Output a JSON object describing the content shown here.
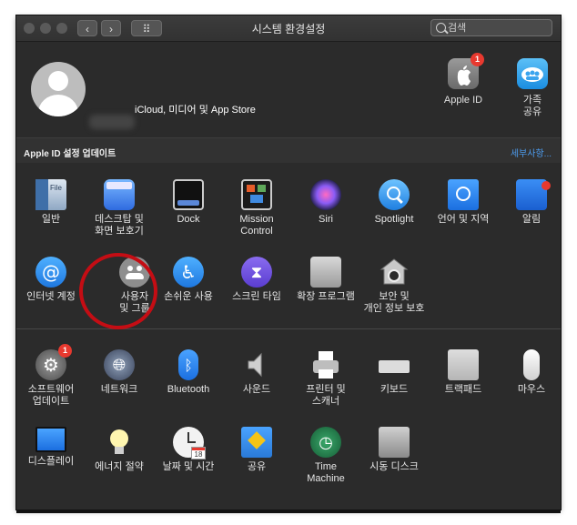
{
  "window": {
    "title": "시스템 환경설정"
  },
  "nav": {
    "back": "‹",
    "forward": "›",
    "grid": "⠿"
  },
  "search": {
    "placeholder": "검색"
  },
  "profile": {
    "subtitle": "iCloud, 미디어 및 App Store"
  },
  "top_items": [
    {
      "label": "Apple ID",
      "icon": "apple-icon",
      "badge": "1"
    },
    {
      "label": "가족\n공유",
      "icon": "family-sharing-icon"
    }
  ],
  "banner": {
    "left": "Apple ID 설정 업데이트",
    "right": "세부사항..."
  },
  "row1": [
    {
      "label": "일반",
      "icon": "general-icon"
    },
    {
      "label": "데스크탑 및\n화면 보호기",
      "icon": "desktop-icon"
    },
    {
      "label": "Dock",
      "icon": "dock-icon"
    },
    {
      "label": "Mission\nControl",
      "icon": "mission-control-icon"
    },
    {
      "label": "Siri",
      "icon": "siri-icon"
    },
    {
      "label": "Spotlight",
      "icon": "spotlight-icon"
    },
    {
      "label": "언어 및 지역",
      "icon": "language-region-icon"
    },
    {
      "label": "알림",
      "icon": "notifications-icon"
    }
  ],
  "row2": [
    {
      "label": "인터넷 계정",
      "icon": "internet-accounts-icon"
    },
    {
      "label": "사용자\n및 그룹",
      "icon": "users-groups-icon"
    },
    {
      "label": "손쉬운 사용",
      "icon": "accessibility-icon"
    },
    {
      "label": "스크린 타임",
      "icon": "screen-time-icon"
    },
    {
      "label": "확장 프로그램",
      "icon": "extensions-icon"
    },
    {
      "label": "보안 및\n개인 정보 보호",
      "icon": "security-privacy-icon"
    }
  ],
  "row3": [
    {
      "label": "소프트웨어\n업데이트",
      "icon": "software-update-icon",
      "badge": "1"
    },
    {
      "label": "네트워크",
      "icon": "network-icon"
    },
    {
      "label": "Bluetooth",
      "icon": "bluetooth-icon"
    },
    {
      "label": "사운드",
      "icon": "sound-icon"
    },
    {
      "label": "프린터 및\n스캐너",
      "icon": "printers-icon"
    },
    {
      "label": "키보드",
      "icon": "keyboard-icon"
    },
    {
      "label": "트랙패드",
      "icon": "trackpad-icon"
    },
    {
      "label": "마우스",
      "icon": "mouse-icon"
    }
  ],
  "row4": [
    {
      "label": "디스플레이",
      "icon": "displays-icon"
    },
    {
      "label": "에너지 절약",
      "icon": "energy-saver-icon"
    },
    {
      "label": "날짜 및 시간",
      "icon": "date-time-icon"
    },
    {
      "label": "공유",
      "icon": "sharing-icon"
    },
    {
      "label": "Time\nMachine",
      "icon": "time-machine-icon"
    },
    {
      "label": "시동 디스크",
      "icon": "startup-disk-icon"
    }
  ],
  "icon_glyphs": {
    "date-time-icon": "18"
  },
  "colors": {
    "accent": "#4d9df0",
    "badge": "#e8392f",
    "annotation": "#c40d14"
  }
}
